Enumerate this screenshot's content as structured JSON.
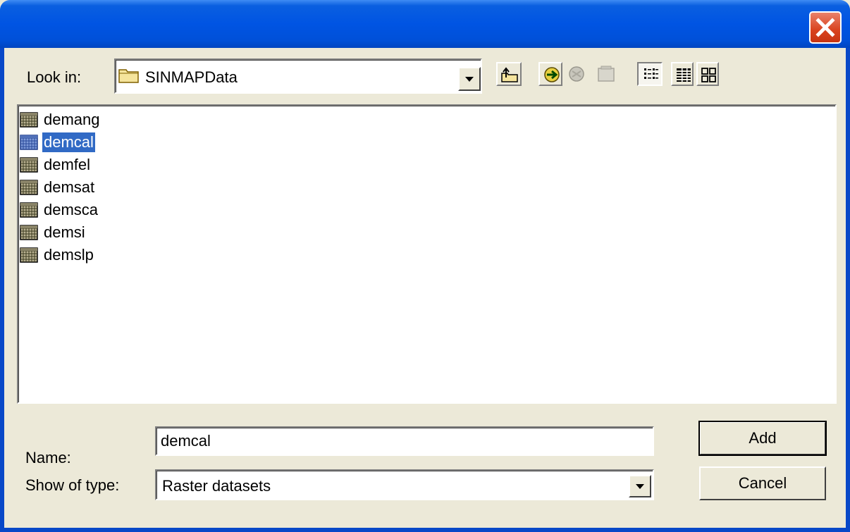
{
  "look_in": {
    "label": "Look in:",
    "value": "SINMAPData"
  },
  "toolbar": {
    "icons": [
      "up-folder-icon",
      "connect-folder-icon",
      "disconnect-folder-icon",
      "catalog-icon",
      "list-view-icon",
      "details-view-icon",
      "thumbnails-view-icon"
    ]
  },
  "files": [
    {
      "name": "demang",
      "selected": false
    },
    {
      "name": "demcal",
      "selected": true
    },
    {
      "name": "demfel",
      "selected": false
    },
    {
      "name": "demsat",
      "selected": false
    },
    {
      "name": "demsca",
      "selected": false
    },
    {
      "name": "demsi",
      "selected": false
    },
    {
      "name": "demslp",
      "selected": false
    }
  ],
  "name_field": {
    "label": "Name:",
    "value": "demcal"
  },
  "type_field": {
    "label": "Show of type:",
    "value": "Raster datasets"
  },
  "buttons": {
    "add": "Add",
    "cancel": "Cancel"
  },
  "colors": {
    "titlebar": "#0054e3",
    "selection": "#316ac5",
    "dialog_bg": "#ece9d8",
    "close_button": "#d9421e"
  }
}
